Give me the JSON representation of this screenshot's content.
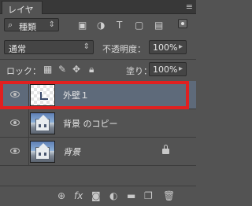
{
  "panel": {
    "tab_label": "レイヤー",
    "menu_icon": "≡"
  },
  "filter": {
    "kind_label": "種類",
    "icons": [
      "image-filter-icon",
      "adjustment-filter-icon",
      "type-filter-icon",
      "shape-filter-icon",
      "smart-object-filter-icon"
    ],
    "toggle": "on"
  },
  "blend": {
    "mode": "通常",
    "opacity_label": "不透明度：",
    "opacity_value": "100%"
  },
  "lock": {
    "label": "ロック：",
    "fill_label": "塗り：",
    "fill_value": "100%"
  },
  "layers": [
    {
      "name": "外壁１",
      "selected": true,
      "italic": false,
      "locked": false
    },
    {
      "name": "背景 のコピー",
      "selected": false,
      "italic": false,
      "locked": false
    },
    {
      "name": "背景",
      "selected": false,
      "italic": true,
      "locked": true
    }
  ],
  "bottom_icons": [
    "link-layers-icon",
    "fx-icon",
    "add-mask-icon",
    "adjustment-layer-icon",
    "group-folder-icon",
    "new-layer-icon",
    "trash-icon"
  ],
  "colors": {
    "panel_bg": "#535353",
    "selected_layer": "#5e6a7a",
    "highlight": "#e02020"
  }
}
